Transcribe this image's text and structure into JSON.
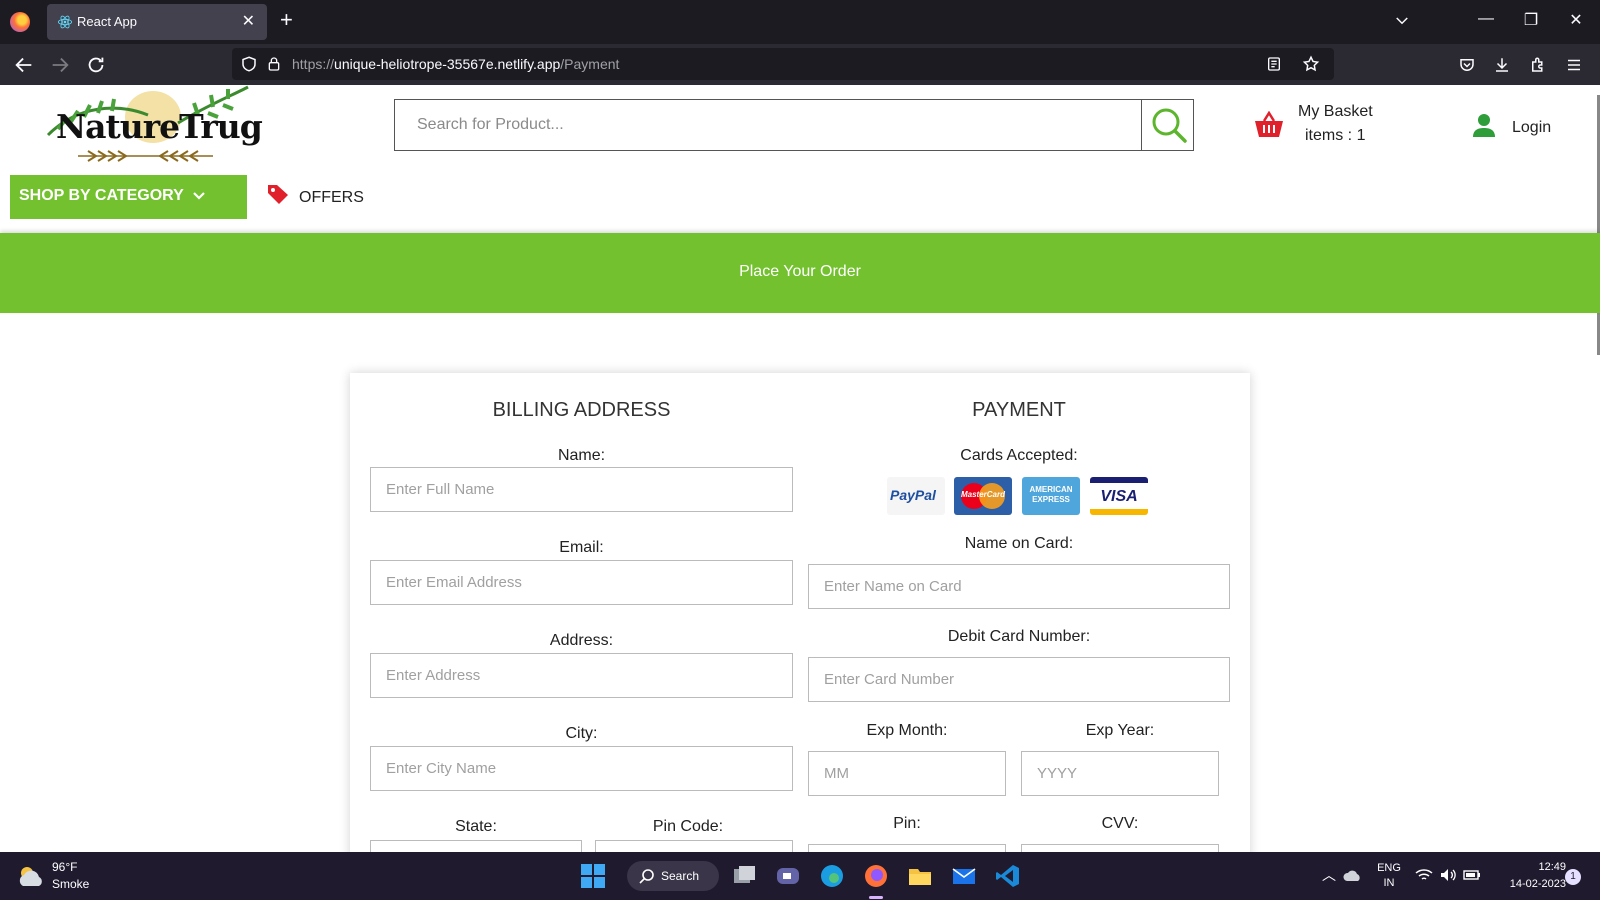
{
  "browser": {
    "tab_title": "React App",
    "url_prefix": "https://",
    "url_host": "unique-heliotrope-35567e.netlify.app",
    "url_path": "/Payment"
  },
  "header": {
    "logo_text": "NatureTrug",
    "search_placeholder": "Search for Product...",
    "basket_title": "My Basket",
    "basket_items": "items : 1",
    "login_label": "Login",
    "category_button": "SHOP BY CATEGORY",
    "offers_label": "OFFERS"
  },
  "banner": {
    "text": "Place Your Order"
  },
  "billing": {
    "title": "BILLING ADDRESS",
    "fields": [
      {
        "label": "Name:",
        "placeholder": "Enter Full Name"
      },
      {
        "label": "Email:",
        "placeholder": "Enter Email Address"
      },
      {
        "label": "Address:",
        "placeholder": "Enter Address"
      },
      {
        "label": "City:",
        "placeholder": "Enter City Name"
      }
    ],
    "state_label": "State:",
    "pin_code_label": "Pin Code:"
  },
  "payment": {
    "title": "PAYMENT",
    "cards_label": "Cards Accepted:",
    "card_brands": [
      {
        "name": "paypal-icon",
        "text": "PayPal"
      },
      {
        "name": "mastercard-icon",
        "text": "MasterCard"
      },
      {
        "name": "amex-icon",
        "text": "AMERICAN EXPRESS"
      },
      {
        "name": "visa-icon",
        "text": "VISA"
      }
    ],
    "name_on_card_label": "Name on Card:",
    "name_on_card_placeholder": "Enter Name on Card",
    "card_number_label": "Debit Card Number:",
    "card_number_placeholder": "Enter Card Number",
    "exp_month_label": "Exp Month:",
    "exp_month_placeholder": "MM",
    "exp_year_label": "Exp Year:",
    "exp_year_placeholder": "YYYY",
    "pin_label": "Pin:",
    "cvv_label": "CVV:"
  },
  "taskbar": {
    "weather_temp": "96°F",
    "weather_desc": "Smoke",
    "search_label": "Search",
    "lang_top": "ENG",
    "lang_bottom": "IN",
    "time": "12:49",
    "date": "14-02-2023",
    "notification_count": "1"
  },
  "colors": {
    "accent_green": "#73c12f",
    "basket_red": "#e0202b"
  }
}
